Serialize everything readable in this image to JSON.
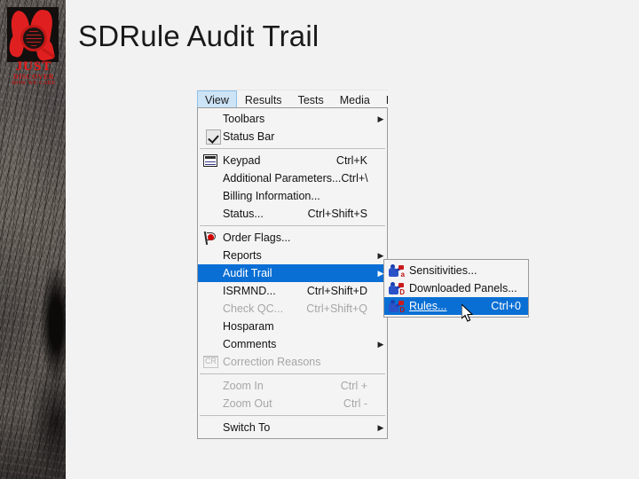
{
  "slide": {
    "title": "SDRule Audit Trail",
    "logo": {
      "line1": "JUST",
      "line2": "DISCOVER",
      "line3": "HOW WE CARE",
      "accent_color": "#e02020"
    }
  },
  "app": {
    "menubar": {
      "items": [
        {
          "label": "View",
          "active": true
        },
        {
          "label": "Results",
          "active": false
        },
        {
          "label": "Tests",
          "active": false
        },
        {
          "label": "Media",
          "active": false
        },
        {
          "label": "Isolat",
          "active": false
        }
      ]
    },
    "view_menu": {
      "groups": [
        {
          "items": [
            {
              "label": "Toolbars",
              "underline_index": 1,
              "accel": "",
              "submenu": true,
              "disabled": false,
              "checked": false,
              "icon": ""
            },
            {
              "label": "Status Bar",
              "underline_index": 8,
              "accel": "",
              "submenu": false,
              "disabled": false,
              "checked": true,
              "icon": "checkbox-icon"
            }
          ]
        },
        {
          "items": [
            {
              "label": "Keypad",
              "underline_index": 0,
              "accel": "Ctrl+K",
              "submenu": false,
              "disabled": false,
              "checked": false,
              "icon": "keypad-icon"
            },
            {
              "label": "Additional Parameters...",
              "underline_index": 11,
              "accel": "Ctrl+\\",
              "submenu": false,
              "disabled": false,
              "checked": false,
              "icon": ""
            },
            {
              "label": "Billing Information...",
              "underline_index": 2,
              "accel": "",
              "submenu": false,
              "disabled": false,
              "checked": false,
              "icon": ""
            },
            {
              "label": "Status...",
              "underline_index": 0,
              "accel": "Ctrl+Shift+S",
              "submenu": false,
              "disabled": false,
              "checked": false,
              "icon": ""
            }
          ]
        },
        {
          "items": [
            {
              "label": "Order Flags...",
              "underline_index": 6,
              "accel": "",
              "submenu": false,
              "disabled": false,
              "checked": false,
              "icon": "order-flag-icon"
            },
            {
              "label": "Reports",
              "underline_index": 0,
              "accel": "",
              "submenu": true,
              "disabled": false,
              "checked": false,
              "icon": ""
            },
            {
              "label": "Audit Trail",
              "underline_index": 0,
              "accel": "",
              "submenu": true,
              "disabled": false,
              "checked": false,
              "icon": "",
              "highlighted": true
            },
            {
              "label": "ISRMND...",
              "underline_index": 5,
              "accel": "Ctrl+Shift+D",
              "submenu": false,
              "disabled": false,
              "checked": false,
              "icon": ""
            },
            {
              "label": "Check QC...",
              "underline_index": 6,
              "accel": "Ctrl+Shift+Q",
              "submenu": false,
              "disabled": true,
              "checked": false,
              "icon": ""
            },
            {
              "label": "Hosparam",
              "underline_index": 0,
              "accel": "",
              "submenu": false,
              "disabled": false,
              "checked": false,
              "icon": ""
            },
            {
              "label": "Comments",
              "underline_index": 0,
              "accel": "",
              "submenu": true,
              "disabled": false,
              "checked": false,
              "icon": ""
            },
            {
              "label": "Correction Reasons",
              "underline_index": -1,
              "accel": "",
              "submenu": false,
              "disabled": true,
              "checked": false,
              "icon": "correction-reasons-icon"
            }
          ]
        },
        {
          "items": [
            {
              "label": "Zoom In",
              "underline_index": 0,
              "accel": "Ctrl  +",
              "submenu": false,
              "disabled": true,
              "checked": false,
              "icon": ""
            },
            {
              "label": "Zoom Out",
              "underline_index": 5,
              "accel": "Ctrl  -",
              "submenu": false,
              "disabled": true,
              "checked": false,
              "icon": ""
            }
          ]
        },
        {
          "items": [
            {
              "label": "Switch To",
              "underline_index": 2,
              "accel": "",
              "submenu": true,
              "disabled": false,
              "checked": false,
              "icon": ""
            }
          ]
        }
      ]
    },
    "audit_trail_submenu": {
      "items": [
        {
          "label": "Sensitivities...",
          "accel": "",
          "icon": "rules-icon",
          "highlighted": false
        },
        {
          "label": "Downloaded Panels...",
          "accel": "",
          "icon": "rules-icon",
          "highlighted": false
        },
        {
          "label": "Rules...",
          "accel": "Ctrl+0",
          "icon": "rules-icon",
          "highlighted": true
        }
      ]
    },
    "colors": {
      "highlight": "#0a6fd4",
      "menu_bg": "#f4f4f4",
      "menu_border": "#9a9a9a",
      "disabled_text": "#a6a6a6",
      "menubar_active_bg": "#cde4f7"
    }
  }
}
